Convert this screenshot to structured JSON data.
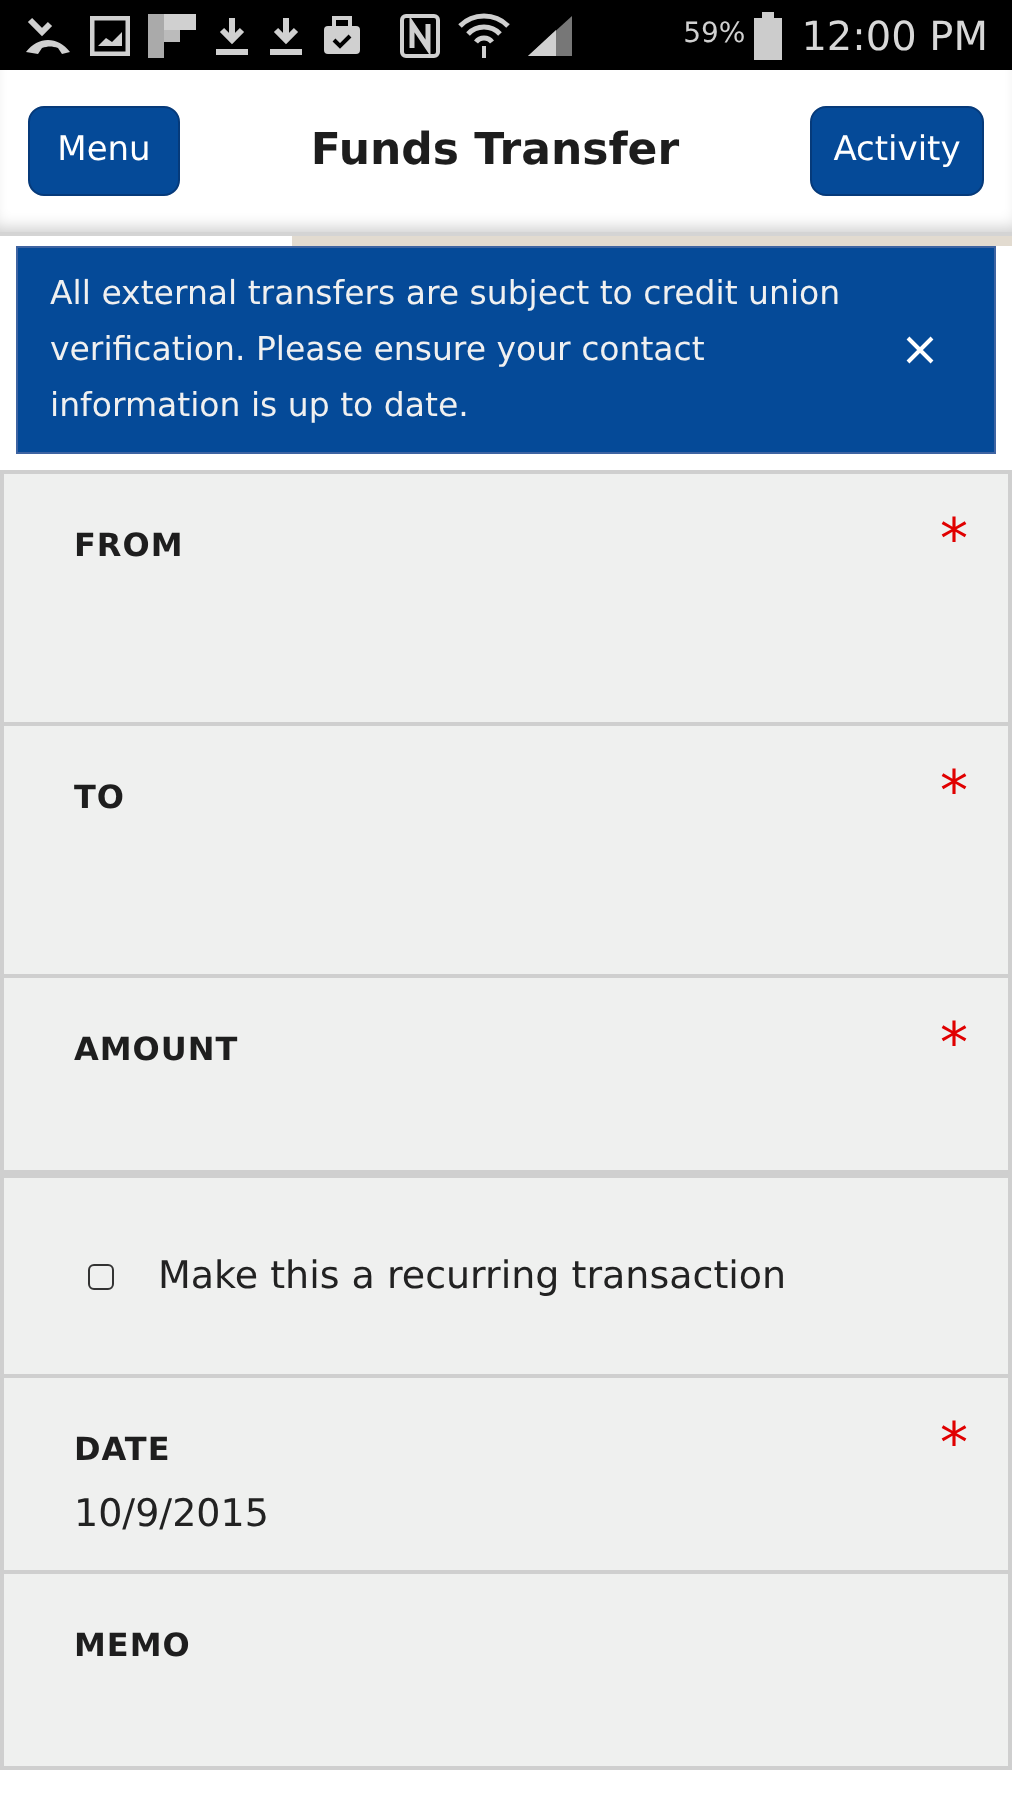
{
  "status_bar": {
    "battery": "59%",
    "time": "12:00 PM"
  },
  "header": {
    "menu_button": "Menu",
    "title": "Funds Transfer",
    "activity_button": "Activity"
  },
  "notice": {
    "text": "All external transfers are subject to credit union verification. Please ensure your contact information is up to date."
  },
  "fields": [
    {
      "kind": "select",
      "label": "FROM",
      "required_mark": "*"
    },
    {
      "kind": "select",
      "label": "TO",
      "required_mark": "*"
    },
    {
      "kind": "input",
      "label": "AMOUNT",
      "required_mark": "*"
    },
    {
      "kind": "checkbox",
      "label": "Make this a recurring transaction",
      "checked": false
    },
    {
      "kind": "input",
      "label": "DATE",
      "required_mark": "*",
      "value": "10/9/2015"
    },
    {
      "kind": "input",
      "label": "MEMO"
    }
  ]
}
